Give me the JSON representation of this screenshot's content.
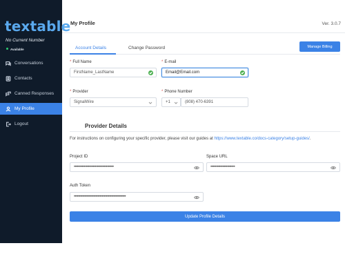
{
  "sidebar": {
    "logo": "textable",
    "current_number": "No Current Number",
    "availability": "Available",
    "items": [
      {
        "label": "Conversations",
        "icon": "chat-bubbles-icon"
      },
      {
        "label": "Contacts",
        "icon": "contacts-icon"
      },
      {
        "label": "Canned Responses",
        "icon": "canned-responses-icon"
      },
      {
        "label": "My Profile",
        "icon": "user-icon",
        "active": true
      },
      {
        "label": "Logout",
        "icon": "logout-icon"
      }
    ]
  },
  "header": {
    "title": "My Profile",
    "version": "Ver. 3.0.7"
  },
  "tabs": [
    {
      "label": "Account Details",
      "active": true
    },
    {
      "label": "Change Password",
      "active": false
    }
  ],
  "manage_billing_label": "Manage Billing",
  "account": {
    "full_name_label": "Full Name",
    "full_name_value": "FirstName_LastName",
    "email_label": "E-mail",
    "email_value": "Email@Email.com",
    "provider_label": "Provider",
    "provider_value": "SignalWire",
    "phone_label": "Phone Number",
    "country_code": "+1",
    "phone_value": "(808) 470-6391"
  },
  "provider_details": {
    "title": "Provider Details",
    "instructions_prefix": "For instructions on configuring your specific provider, please visit our guides at ",
    "instructions_link": "https://www.textable.co/docs-category/setup-guides/",
    "instructions_suffix": ".",
    "project_id_label": "Project ID",
    "project_id_value": "••••••••••••••••••••••••••••••••••••",
    "space_url_label": "Space URL",
    "space_url_value": "••••••••••••••••••••••",
    "auth_token_label": "Auth Token",
    "auth_token_value": "••••••••••••••••••••••••••••••••••••••••••••••••••"
  },
  "update_button_label": "Update Profile Details",
  "colors": {
    "sidebar_bg": "#0f1b2a",
    "accent": "#3b82e6",
    "logo": "#5aa9ee",
    "success": "#4caf50",
    "required": "#d9534f"
  }
}
